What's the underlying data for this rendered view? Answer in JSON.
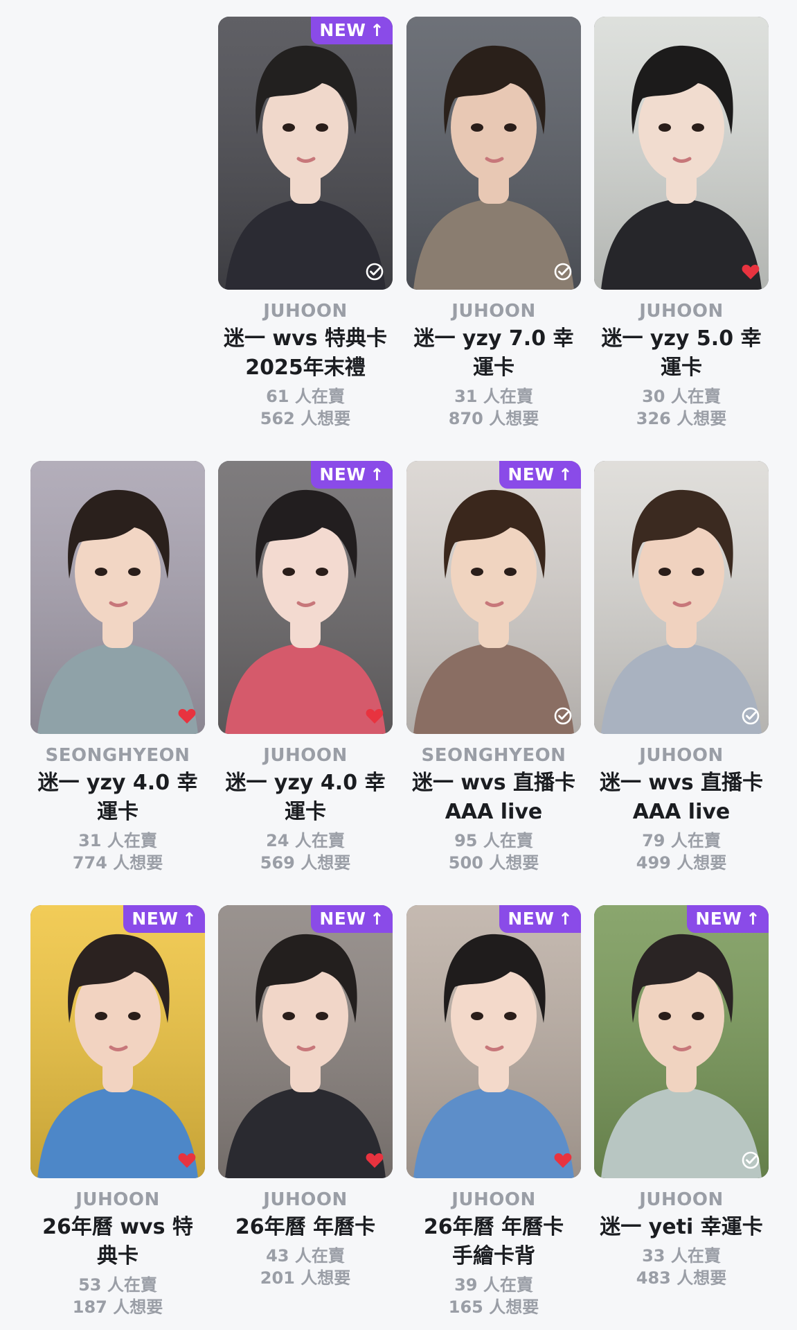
{
  "cards": [
    {
      "artist": "JUHOON",
      "title": [
        "迷一 wvs 特典卡",
        "2025年末禮"
      ],
      "selling": "61 人在賣",
      "wanted": "562 人想要",
      "is_new": true,
      "status": "check",
      "bg": "#4a4a50",
      "skin": "#f0d8cb",
      "hair": "#22201f",
      "shirt": "#2b2b33"
    },
    {
      "artist": "JUHOON",
      "title": [
        "迷一 yzy 7.0 幸",
        "運卡"
      ],
      "selling": "31 人在賣",
      "wanted": "870 人想要",
      "is_new": false,
      "status": "check",
      "bg": "#5a5e66",
      "skin": "#e8c8b4",
      "hair": "#2a201a",
      "shirt": "#8a7d70"
    },
    {
      "artist": "JUHOON",
      "title": [
        "迷一 yzy 5.0 幸",
        "運卡"
      ],
      "selling": "30 人在賣",
      "wanted": "326 人想要",
      "is_new": false,
      "status": "heart",
      "bg": "#d9dcd8",
      "skin": "#f1dccf",
      "hair": "#1c1b1b",
      "shirt": "#26262a"
    },
    {
      "artist": "SEONGHYEON",
      "title": [
        "迷一 yzy 4.0 幸",
        "運卡"
      ],
      "selling": "31 人在賣",
      "wanted": "774 人想要",
      "is_new": false,
      "status": "heart",
      "bg": "#a9a3b1",
      "skin": "#f2d6c4",
      "hair": "#2a201c",
      "shirt": "#8fa2a8"
    },
    {
      "artist": "JUHOON",
      "title": [
        "迷一 yzy 4.0 幸",
        "運卡"
      ],
      "selling": "24 人在賣",
      "wanted": "569 人想要",
      "is_new": true,
      "status": "heart",
      "bg": "#6d6a6c",
      "skin": "#f3dad0",
      "hair": "#221e1f",
      "shirt": "#d55a6b"
    },
    {
      "artist": "SEONGHYEON",
      "title": [
        "迷一 wvs 直播卡",
        "AAA live"
      ],
      "selling": "95 人在賣",
      "wanted": "500 人想要",
      "is_new": true,
      "status": "check",
      "bg": "#d8d3cf",
      "skin": "#f0d4c0",
      "hair": "#3a271c",
      "shirt": "#8a6e63"
    },
    {
      "artist": "JUHOON",
      "title": [
        "迷一 wvs 直播卡",
        "AAA live"
      ],
      "selling": "79 人在賣",
      "wanted": "499 人想要",
      "is_new": false,
      "status": "check",
      "bg": "#dcdad6",
      "skin": "#f0d2bf",
      "hair": "#3b2a20",
      "shirt": "#a9b2c0"
    },
    {
      "artist": "JUHOON",
      "title": [
        "26年曆 wvs 特",
        "典卡"
      ],
      "selling": "53 人在賣",
      "wanted": "187 人想要",
      "is_new": true,
      "status": "heart",
      "bg": "#f0c541",
      "skin": "#f2d3c1",
      "hair": "#2b2220",
      "shirt": "#4d87c8"
    },
    {
      "artist": "JUHOON",
      "title": [
        "26年曆 年曆卡"
      ],
      "selling": "43 人在賣",
      "wanted": "201 人想要",
      "is_new": true,
      "status": "heart",
      "bg": "#8c8480",
      "skin": "#f1d6c8",
      "hair": "#231f1e",
      "shirt": "#2a2a30"
    },
    {
      "artist": "JUHOON",
      "title": [
        "26年曆 年曆卡",
        "手繪卡背"
      ],
      "selling": "39 人在賣",
      "wanted": "165 人想要",
      "is_new": true,
      "status": "heart",
      "bg": "#bdb0a6",
      "skin": "#f3d9ca",
      "hair": "#1f1c1c",
      "shirt": "#5d8ec9"
    },
    {
      "artist": "JUHOON",
      "title": [
        "迷一 yeti 幸運卡"
      ],
      "selling": "33 人在賣",
      "wanted": "483 人想要",
      "is_new": true,
      "status": "check",
      "bg": "#7a9a5a",
      "skin": "#f0d3c0",
      "hair": "#2a2424",
      "shirt": "#b8c6c2"
    }
  ],
  "badge": {
    "label": "NEW",
    "arrow": "↑"
  },
  "colors": {
    "accent": "#8a4be8",
    "heart": "#e8333f",
    "check": "#ffffff"
  },
  "icons": {
    "status_check": "check-circle-icon",
    "status_heart": "heart-icon",
    "badge_arrow": "arrow-up-icon"
  }
}
